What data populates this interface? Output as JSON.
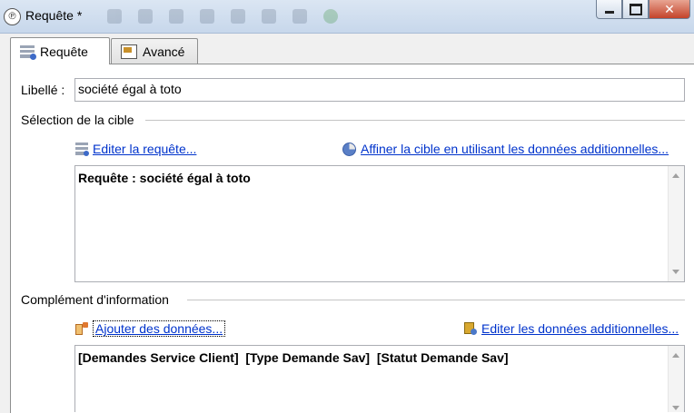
{
  "window": {
    "title": "Requête *",
    "minimize_glyph": "",
    "close_glyph": "✕"
  },
  "tabs": [
    {
      "label": "Requête",
      "icon": "query-icon",
      "active": true
    },
    {
      "label": "Avancé",
      "icon": "advanced-icon",
      "active": false
    }
  ],
  "form": {
    "libelle_label": "Libellé :",
    "libelle_value": "société égal à toto"
  },
  "target_section": {
    "title": "Sélection de la cible",
    "edit_query_link": "Editer la requête...",
    "refine_link": "Affiner la cible en utilisant les données additionnelles...",
    "query_text": "Requête : société égal à toto"
  },
  "info_section": {
    "title": "Complément d'information",
    "add_data_link": "Ajouter des données...",
    "edit_data_link": "Editer les données additionnelles...",
    "data_text": "[Demandes Service Client]  [Type Demande Sav]  [Statut Demande Sav]"
  },
  "colors": {
    "link": "#0033cc",
    "close_button": "#c4432a",
    "titlebar": "#c7d7eb"
  }
}
